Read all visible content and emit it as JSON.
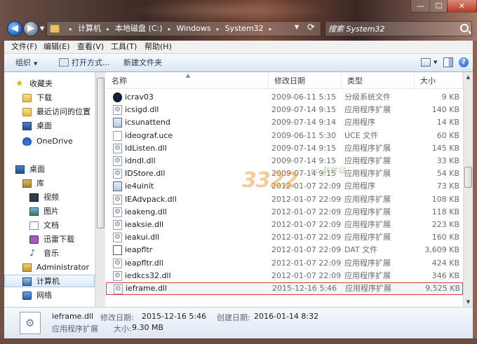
{
  "window": {
    "minimize": "—",
    "maximize": "☐",
    "close": "✕"
  },
  "address": {
    "crumbs": [
      "计算机",
      "本地磁盘 (C:)",
      "Windows",
      "System32"
    ],
    "separator": "▸"
  },
  "search": {
    "placeholder": "搜索 System32"
  },
  "menu": [
    "文件(F)",
    "编辑(E)",
    "查看(V)",
    "工具(T)",
    "帮助(H)"
  ],
  "toolbar": {
    "organize": "组织",
    "open_with": "打开方式...",
    "new_folder": "新建文件夹"
  },
  "nav": {
    "favorites": "收藏夹",
    "downloads": "下载",
    "recent": "最近访问的位置",
    "desktop1": "桌面",
    "onedrive": "OneDrive",
    "desktop2": "桌面",
    "library": "库",
    "videos": "视频",
    "pictures": "图片",
    "documents": "文档",
    "thunder": "迅雷下载",
    "music": "音乐",
    "administrator": "Administrator",
    "computer": "计算机",
    "network": "网络"
  },
  "columns": {
    "name": "名称",
    "date": "修改日期",
    "type": "类型",
    "size": "大小"
  },
  "files": [
    {
      "name": "icrav03",
      "date": "2009-06-11 5:15",
      "type": "分级系统文件",
      "size": "9 KB",
      "icon": "special"
    },
    {
      "name": "icsigd.dll",
      "date": "2009-07-14 9:15",
      "type": "应用程序扩展",
      "size": "140 KB",
      "icon": "gear"
    },
    {
      "name": "icsunattend",
      "date": "2009-07-14 9:14",
      "type": "应用程序",
      "size": "14 KB",
      "icon": "exe"
    },
    {
      "name": "ideograf.uce",
      "date": "2009-06-11 5:30",
      "type": "UCE 文件",
      "size": "60 KB",
      "icon": "blank"
    },
    {
      "name": "IdListen.dll",
      "date": "2009-07-14 9:15",
      "type": "应用程序扩展",
      "size": "145 KB",
      "icon": "gear"
    },
    {
      "name": "idndl.dll",
      "date": "2009-07-14 9:15",
      "type": "应用程序扩展",
      "size": "33 KB",
      "icon": "gear"
    },
    {
      "name": "IDStore.dll",
      "date": "2009-07-14 9:15",
      "type": "应用程序扩展",
      "size": "54 KB",
      "icon": "gear"
    },
    {
      "name": "ie4uinit",
      "date": "2012-01-07 22:09",
      "type": "应用程序",
      "size": "73 KB",
      "icon": "exe"
    },
    {
      "name": "IEAdvpack.dll",
      "date": "2012-01-07 22:09",
      "type": "应用程序扩展",
      "size": "108 KB",
      "icon": "gear"
    },
    {
      "name": "ieakeng.dll",
      "date": "2012-01-07 22:09",
      "type": "应用程序扩展",
      "size": "118 KB",
      "icon": "gear"
    },
    {
      "name": "ieaksie.dll",
      "date": "2012-01-07 22:09",
      "type": "应用程序扩展",
      "size": "223 KB",
      "icon": "gear"
    },
    {
      "name": "ieakui.dll",
      "date": "2012-01-07 22:09",
      "type": "应用程序扩展",
      "size": "160 KB",
      "icon": "gear"
    },
    {
      "name": "ieapfltr",
      "date": "2012-01-07 22:09",
      "type": "DAT 文件",
      "size": "3,609 KB",
      "icon": "dat"
    },
    {
      "name": "ieapfltr.dll",
      "date": "2012-01-07 22:09",
      "type": "应用程序扩展",
      "size": "424 KB",
      "icon": "gear"
    },
    {
      "name": "iedkcs32.dll",
      "date": "2012-01-07 22:09",
      "type": "应用程序扩展",
      "size": "346 KB",
      "icon": "gear"
    },
    {
      "name": "ieframe.dll",
      "date": "2015-12-16 5:46",
      "type": "应用程序扩展",
      "size": "9,525 KB",
      "icon": "gear"
    }
  ],
  "watermark": {
    "main": "3322",
    "sub": ".cc 软件站"
  },
  "details": {
    "filename": "ieframe.dll",
    "modified_label": "修改日期:",
    "modified_value": "2015-12-16 5:46",
    "created_label": "创建日期:",
    "created_value": "2016-01-14 8:32",
    "type": "应用程序扩展",
    "size_label": "大小:",
    "size_value": "9.30 MB"
  }
}
